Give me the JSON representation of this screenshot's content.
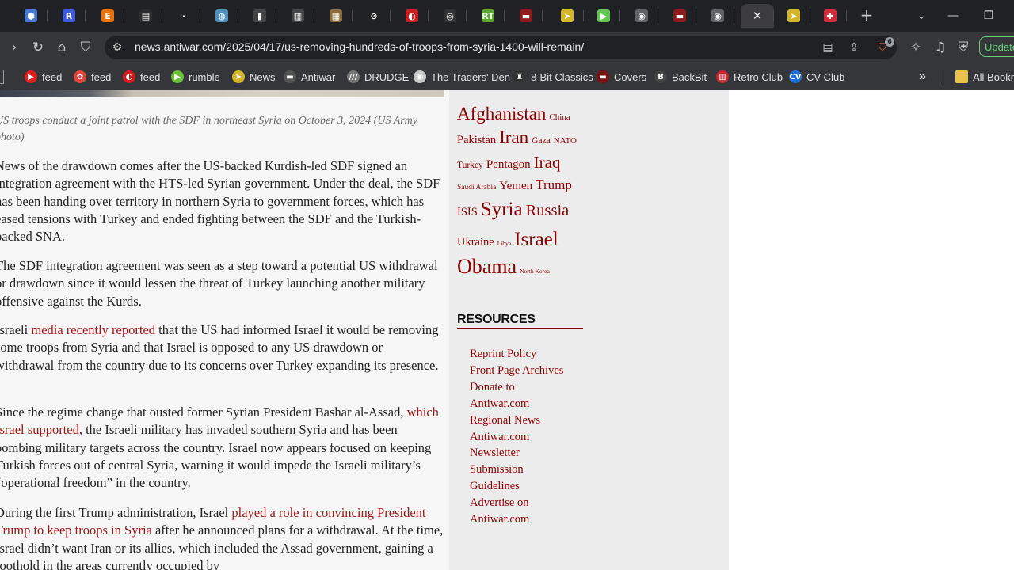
{
  "browser": {
    "tabs": [
      {
        "icon": "shield-tab-icon",
        "color": "#4a7bd4",
        "glyph": "⬢"
      },
      {
        "icon": "r-tab-icon",
        "color": "#3b5bdb",
        "glyph": "R"
      },
      {
        "icon": "e-tab-icon",
        "color": "#e8730c",
        "glyph": "E"
      },
      {
        "icon": "clipboard-tab-icon",
        "color": "#2c2c2c",
        "glyph": "▤"
      },
      {
        "icon": "dots-tab-icon",
        "color": "#202124",
        "glyph": "·"
      },
      {
        "icon": "globe-tab-icon",
        "color": "#4d8fbf",
        "glyph": "◍"
      },
      {
        "icon": "doc-tab-icon",
        "color": "#444",
        "glyph": "▮"
      },
      {
        "icon": "trash-tab-icon",
        "color": "#444",
        "glyph": "▥"
      },
      {
        "icon": "image-tab-icon",
        "color": "#8a6d3b",
        "glyph": "▦"
      },
      {
        "icon": "nocircle-tab-icon",
        "color": "#222",
        "glyph": "⊘"
      },
      {
        "icon": "swirl-tab-icon",
        "color": "#c81e1e",
        "glyph": "◐"
      },
      {
        "icon": "mask-tab-icon",
        "color": "#333",
        "glyph": "◎"
      },
      {
        "icon": "rt-tab-icon",
        "color": "#5aa832",
        "glyph": "RT"
      },
      {
        "icon": "flag-tab-icon",
        "color": "#8b1d1d",
        "glyph": "▬"
      },
      {
        "icon": "bird-tab-icon",
        "color": "#d2b52a",
        "glyph": "➤"
      },
      {
        "icon": "play-tab-icon",
        "color": "#62c554",
        "glyph": "▶"
      },
      {
        "icon": "avatar-tab-icon",
        "color": "#5f6368",
        "glyph": "◉"
      },
      {
        "icon": "flag2-tab-icon",
        "color": "#8b1d1d",
        "glyph": "▬"
      },
      {
        "icon": "avatar2-tab-icon",
        "color": "#5f6368",
        "glyph": "◉"
      },
      {
        "icon": "close-tab-icon",
        "color": "",
        "glyph": "✕"
      },
      {
        "icon": "bird2-tab-icon",
        "color": "#d2b52a",
        "glyph": "➤"
      },
      {
        "icon": "ball-tab-icon",
        "color": "#d12b3a",
        "glyph": "✚"
      }
    ],
    "new_tab": "+",
    "tab_search": "⌄",
    "minimize": "—",
    "restore": "❐",
    "url": "news.antiwar.com/2025/04/17/us-removing-hundreds-of-troops-from-syria-1400-will-remain/",
    "update_label": "Update",
    "brave_badge": "6"
  },
  "bookmarks": [
    {
      "label": "feed",
      "icon": "youtube-icon",
      "color": "#e02020",
      "glyph": "▶"
    },
    {
      "label": "feed",
      "icon": "paw-icon",
      "color": "#e0443c",
      "glyph": "✿"
    },
    {
      "label": "feed",
      "icon": "swirl-icon",
      "color": "#d11a1a",
      "glyph": "◐"
    },
    {
      "label": "rumble",
      "icon": "rumble-icon",
      "color": "#6bbf3a",
      "glyph": "▶"
    },
    {
      "label": "News",
      "icon": "bird-icon",
      "color": "#d2b52a",
      "glyph": "➤"
    },
    {
      "label": "Antiwar",
      "icon": "dash-icon",
      "color": "#555",
      "glyph": "▬"
    },
    {
      "label": "DRUDGE",
      "icon": "drudge-icon",
      "color": "#777",
      "glyph": "///"
    },
    {
      "label": "The Traders' Den",
      "icon": "traders-icon",
      "color": "#c9c9c9",
      "glyph": "◉"
    },
    {
      "label": "8-Bit Classics",
      "icon": "ship-icon",
      "color": "#333",
      "glyph": "♜"
    },
    {
      "label": "Covers",
      "icon": "covers-icon",
      "color": "#7a1010",
      "glyph": "▬"
    },
    {
      "label": "BackBit",
      "icon": "backbit-icon",
      "color": "#444",
      "glyph": "B"
    },
    {
      "label": "Retro Club",
      "icon": "retro-icon",
      "color": "#c8262d",
      "glyph": "▥"
    },
    {
      "label": "CV Club",
      "icon": "cv-icon",
      "color": "#1e6fd9",
      "glyph": "CV"
    }
  ],
  "bookmarks_more": "»",
  "all_bookmarks": "All Bookm",
  "article": {
    "caption": "US troops conduct a joint patrol with the SDF in northeast Syria on October 3, 2024 (US Army photo)",
    "p1": "News of the drawdown comes after the US-backed Kurdish-led SDF signed an integration agreement with the HTS-led Syrian government. Under the deal, the SDF has been handing over territory in northern Syria to government forces, which has eased tensions with Turkey and ended fighting between the SDF and the Turkish-backed SNA.",
    "p2": "The SDF integration agreement was seen as a step toward a potential US withdrawal or drawdown since it would lessen the threat of Turkey launching another military offensive against the Kurds.",
    "p3_pre": "Israeli ",
    "p3_link": "media recently reported",
    "p3_post": " that the US had informed Israel it would be removing some troops from Syria and that Israel is opposed to any US drawdown or withdrawal from the country due to its concerns over Turkey expanding its presence.",
    "p4_pre": "Since the regime change that ousted former Syrian President Bashar al-Assad, ",
    "p4_link": "which Israel supported",
    "p4_post": ", the Israeli military has invaded southern Syria and has been bombing military targets across the country. Israel now appears focused on keeping Turkish forces out of central Syria, warning it would impede the Israeli military’s “operational freedom” in the country.",
    "p5_pre": "During the first Trump administration, Israel ",
    "p5_link": "played a role in convincing President Trump to keep troops in Syria",
    "p5_post": " after he announced plans for a withdrawal. At the time, Israel didn’t want Iran or its allies, which included the Assad government, gaining a foothold in the areas currently occupied by"
  },
  "sidebar": {
    "tags": [
      {
        "label": "Afghanistan",
        "size": 23
      },
      {
        "label": "China",
        "size": 11
      },
      {
        "label": "Pakistan",
        "size": 14.5
      },
      {
        "label": "Iran",
        "size": 23
      },
      {
        "label": "Gaza",
        "size": 11.5
      },
      {
        "label": "NATO",
        "size": 11
      },
      {
        "label": "Turkey",
        "size": 11.5
      },
      {
        "label": "Pentagon",
        "size": 15
      },
      {
        "label": "Iraq",
        "size": 21
      },
      {
        "label": "Saudi Arabia",
        "size": 9.5
      },
      {
        "label": "Yemen",
        "size": 15
      },
      {
        "label": "Trump",
        "size": 17
      },
      {
        "label": "ISIS",
        "size": 14.5
      },
      {
        "label": "Syria",
        "size": 25
      },
      {
        "label": "Russia",
        "size": 20.5
      },
      {
        "label": "Ukraine",
        "size": 14.5
      },
      {
        "label": "Libya",
        "size": 7.5
      },
      {
        "label": "Israel",
        "size": 25
      },
      {
        "label": "Obama",
        "size": 26
      },
      {
        "label": "North Korea",
        "size": 7.5
      }
    ],
    "resources_title": "RESOURCES",
    "resources": [
      "Reprint Policy",
      "Front Page Archives",
      "Donate to",
      "Antiwar.com",
      "Regional News",
      "Antiwar.com",
      "Newsletter",
      "Submission",
      "Guidelines",
      "Advertise on",
      "Antiwar.com"
    ]
  }
}
